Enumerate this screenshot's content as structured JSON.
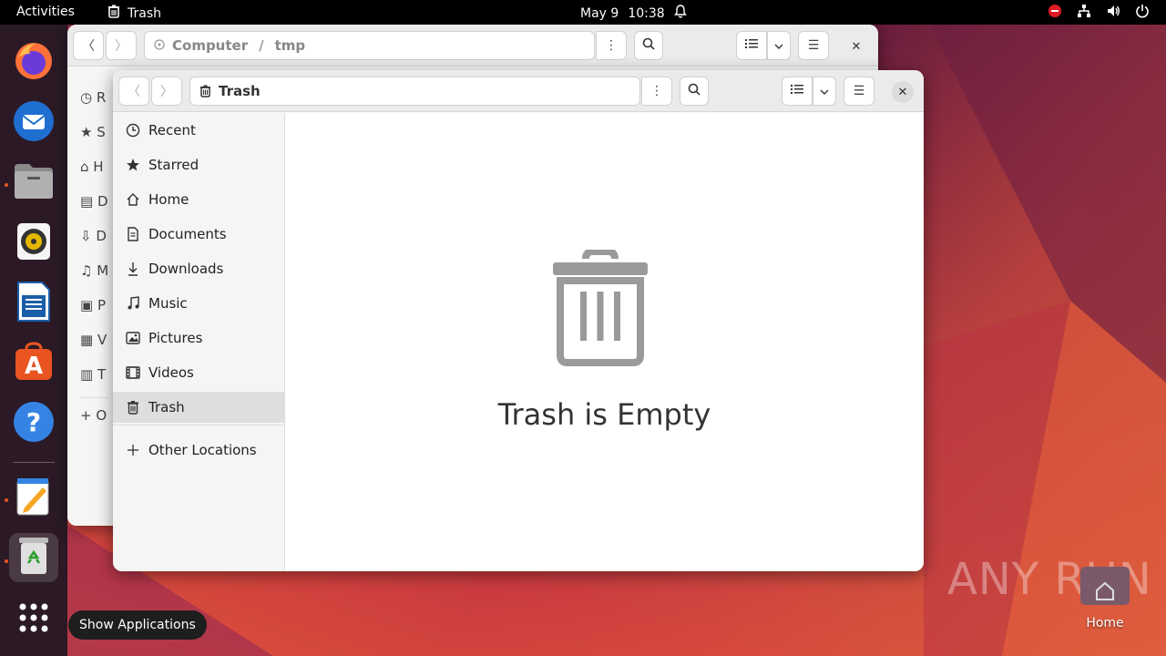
{
  "topbar": {
    "activities": "Activities",
    "app_name": "Trash",
    "date": "May 9",
    "time": "10:38"
  },
  "dock": {
    "tooltip": "Show Applications",
    "items": [
      "firefox",
      "thunderbird",
      "files",
      "rhythmbox",
      "libreoffice-writer",
      "app-center",
      "help",
      "text-editor",
      "trash",
      "show-applications"
    ]
  },
  "desktop": {
    "home_label": "Home",
    "watermark": "ANY RUN"
  },
  "back_window": {
    "path_root": "Computer",
    "path_sep": "/",
    "path_current": "tmp",
    "sidebar_letters": [
      "R",
      "S",
      "H",
      "D",
      "D",
      "M",
      "P",
      "V",
      "T",
      "O"
    ]
  },
  "front_window": {
    "location": "Trash",
    "sidebar": {
      "items": [
        {
          "label": "Recent",
          "icon": "clock-icon"
        },
        {
          "label": "Starred",
          "icon": "star-icon"
        },
        {
          "label": "Home",
          "icon": "home-icon"
        },
        {
          "label": "Documents",
          "icon": "document-icon"
        },
        {
          "label": "Downloads",
          "icon": "download-icon"
        },
        {
          "label": "Music",
          "icon": "music-icon"
        },
        {
          "label": "Pictures",
          "icon": "picture-icon"
        },
        {
          "label": "Videos",
          "icon": "video-icon"
        },
        {
          "label": "Trash",
          "icon": "trash-icon"
        }
      ],
      "other_locations": "Other Locations"
    },
    "empty_state": "Trash is Empty"
  },
  "colors": {
    "accent": "#e95420",
    "topbar": "#000000",
    "dock": "#2b1a26"
  }
}
